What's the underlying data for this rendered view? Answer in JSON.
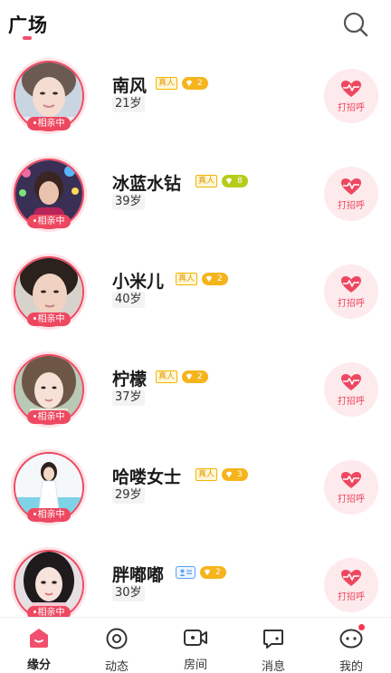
{
  "header": {
    "title": "广场",
    "search_icon": "search-icon"
  },
  "colors": {
    "accent": "#ee4861",
    "level_badge": "#f6b41c",
    "level_badge_green": "#b6cc1b",
    "real_badge": "#f4b400",
    "greet_bg": "#fdeaec"
  },
  "users": [
    {
      "name": "南风",
      "age": "21岁",
      "status": "相亲中",
      "badge": "真人",
      "level": "2",
      "level_color": "orange",
      "greet_label": "打招呼"
    },
    {
      "name": "冰蓝水钻",
      "age": "39岁",
      "status": "相亲中",
      "badge": "真人",
      "level": "8",
      "level_color": "green",
      "greet_label": "打招呼"
    },
    {
      "name": "小米儿",
      "age": "40岁",
      "status": "相亲中",
      "badge": "真人",
      "level": "2",
      "level_color": "orange",
      "greet_label": "打招呼"
    },
    {
      "name": "柠檬",
      "age": "37岁",
      "status": "相亲中",
      "badge": "真人",
      "level": "2",
      "level_color": "orange",
      "greet_label": "打招呼"
    },
    {
      "name": "哈喽女士",
      "age": "29岁",
      "status": "相亲中",
      "badge": "真人",
      "level": "3",
      "level_color": "orange",
      "greet_label": "打招呼"
    },
    {
      "name": "胖嘟嘟",
      "age": "30岁",
      "status": "相亲中",
      "badge": "id-card-icon",
      "level": "2",
      "level_color": "orange",
      "greet_label": "打招呼"
    }
  ],
  "tabs": [
    {
      "label": "缘分",
      "icon": "home-icon",
      "active": true
    },
    {
      "label": "动态",
      "icon": "moments-icon",
      "active": false
    },
    {
      "label": "房间",
      "icon": "video-room-icon",
      "active": false
    },
    {
      "label": "消息",
      "icon": "message-icon",
      "active": false
    },
    {
      "label": "我的",
      "icon": "profile-chat-icon",
      "active": false,
      "has_dot": true
    }
  ]
}
